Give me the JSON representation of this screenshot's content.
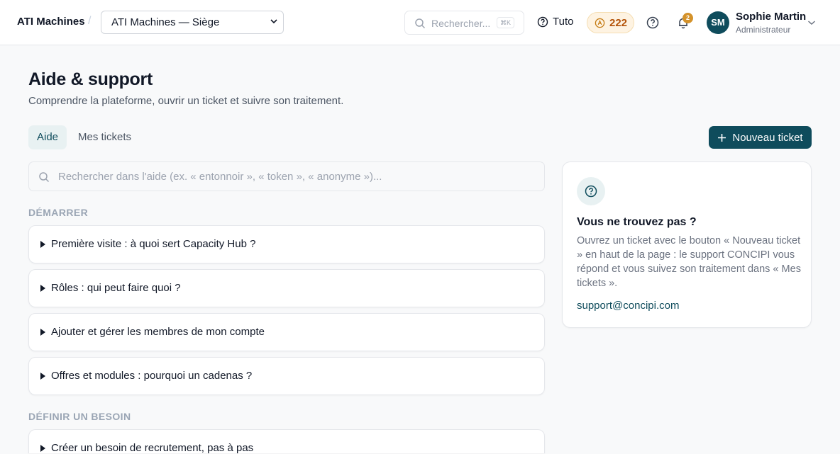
{
  "header": {
    "brand": "ATI Machines",
    "separator": "/",
    "org_select": "ATI Machines — Siège",
    "search_placeholder": "Rechercher...",
    "search_shortcut": "⌘K",
    "tuto_label": "Tuto",
    "coins": "222",
    "notification_count": "2",
    "user": {
      "initials": "SM",
      "name": "Sophie Martin",
      "role": "Administrateur"
    }
  },
  "page": {
    "title": "Aide & support",
    "subtitle": "Comprendre la plateforme, ouvrir un ticket et suivre son traitement.",
    "tabs": [
      {
        "label": "Aide",
        "active": true
      },
      {
        "label": "Mes tickets",
        "active": false
      }
    ],
    "new_ticket_label": "Nouveau ticket",
    "help_search_placeholder": "Rechercher dans l'aide (ex. « entonnoir », « token », « anonyme »)..."
  },
  "sections": [
    {
      "label": "DÉMARRER",
      "items": [
        "Première visite : à quoi sert Capacity Hub ?",
        "Rôles : qui peut faire quoi ?",
        "Ajouter et gérer les membres de mon compte",
        "Offres et modules : pourquoi un cadenas ?"
      ]
    },
    {
      "label": "DÉFINIR UN BESOIN",
      "items": [
        "Créer un besoin de recrutement, pas à pas"
      ]
    }
  ],
  "side_card": {
    "title": "Vous ne trouvez pas ?",
    "text": "Ouvrez un ticket avec le bouton « Nouveau ticket » en haut de la page : le support CONCIPI vous répond et vous suivez son traitement dans « Mes tickets ».",
    "email": "support@concipi.com"
  },
  "colors": {
    "accent": "#0f4c5c",
    "coin": "#b45309",
    "badge": "#d4922a"
  }
}
